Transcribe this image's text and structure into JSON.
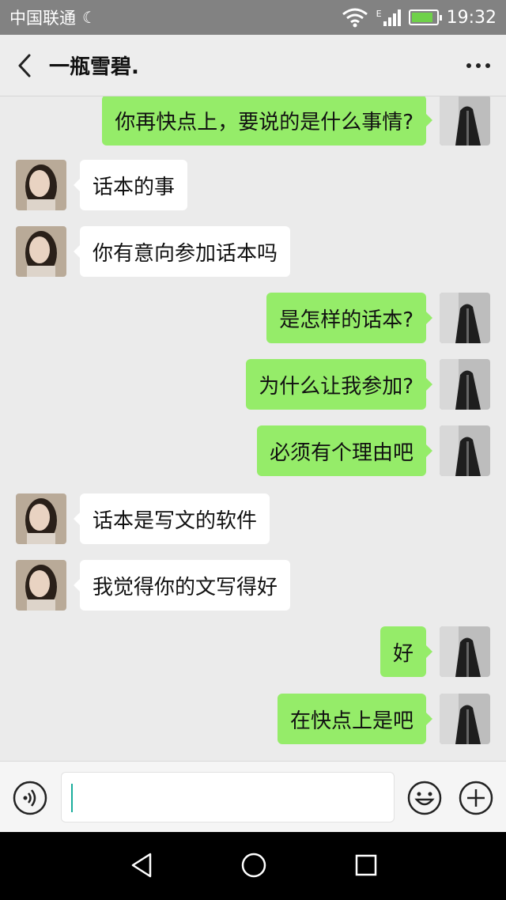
{
  "status_bar": {
    "carrier": "中国联通",
    "time": "19:32",
    "network_type": "E"
  },
  "header": {
    "title": "一瓶雪碧."
  },
  "messages": [
    {
      "side": "right",
      "text": "你再快点上，要说的是什么事情?"
    },
    {
      "side": "left",
      "text": "话本的事"
    },
    {
      "side": "left",
      "text": "你有意向参加话本吗"
    },
    {
      "side": "right",
      "text": "是怎样的话本?"
    },
    {
      "side": "right",
      "text": "为什么让我参加?"
    },
    {
      "side": "right",
      "text": "必须有个理由吧"
    },
    {
      "side": "left",
      "text": "话本是写文的软件"
    },
    {
      "side": "left",
      "text": "我觉得你的文写得好"
    },
    {
      "side": "right",
      "text": "好"
    },
    {
      "side": "right",
      "text": "在快点上是吧"
    }
  ],
  "input": {
    "value": ""
  },
  "colors": {
    "my_bubble": "#95ec69",
    "their_bubble": "#ffffff",
    "chat_background": "#ebebeb",
    "status_bar": "#828282"
  },
  "icons": {
    "back": "chevron-left-icon",
    "more": "more-dots-icon",
    "voice": "voice-icon",
    "emoji": "emoji-icon",
    "plus": "plus-icon"
  }
}
